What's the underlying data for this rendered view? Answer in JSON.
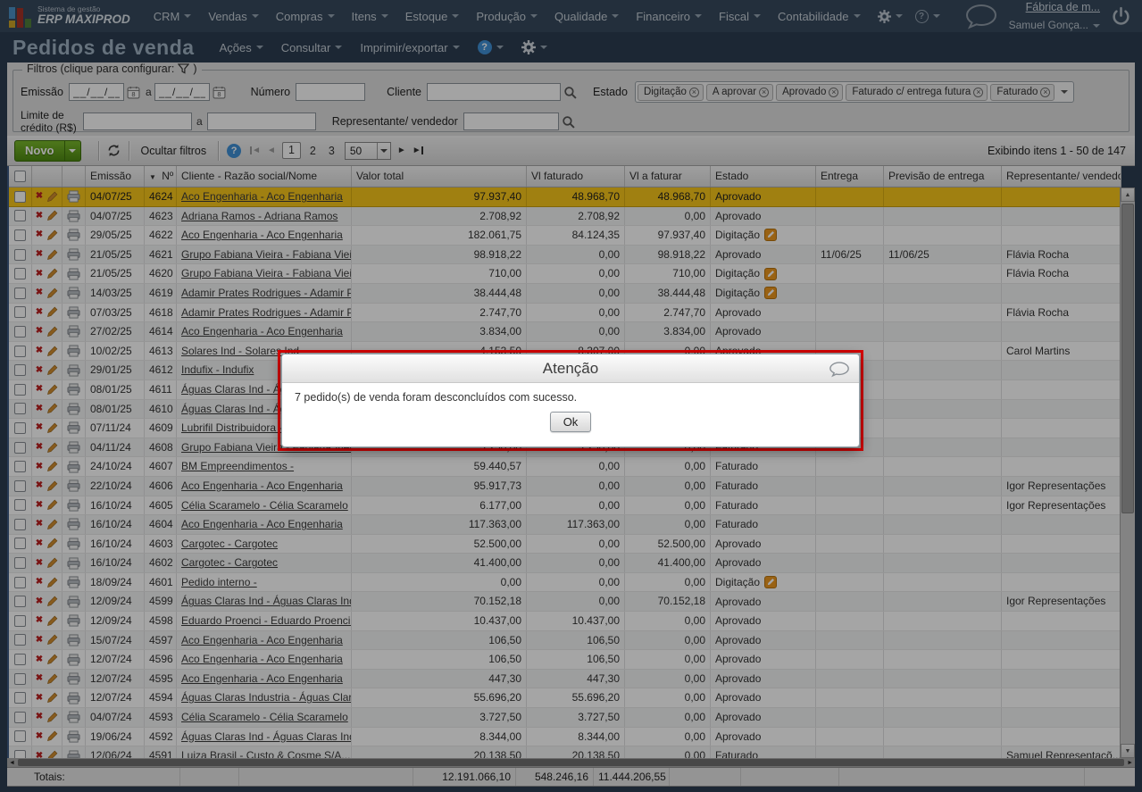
{
  "topnav": {
    "brand_small": "Sistema de gestão",
    "brand": "ERP MAXIPROD",
    "menus": [
      "CRM",
      "Vendas",
      "Compras",
      "Itens",
      "Estoque",
      "Produção",
      "Qualidade",
      "Financeiro",
      "Fiscal",
      "Contabilidade"
    ],
    "company": "Fábrica de m...",
    "user": "Samuel Gonça..."
  },
  "titlebar": {
    "title": "Pedidos de venda",
    "menus": [
      "Ações",
      "Consultar",
      "Imprimir/exportar"
    ]
  },
  "filters": {
    "legend": "Filtros (clique para configurar:",
    "legend_suffix": ")",
    "emissao_label": "Emissão",
    "a_label": "a",
    "date_placeholder": "__/__/__",
    "numero_label": "Número",
    "cliente_label": "Cliente",
    "estado_label": "Estado",
    "estado_chips": [
      "Digitação",
      "A aprovar",
      "Aprovado",
      "Faturado c/ entrega futura",
      "Faturado"
    ],
    "limite_label": "Limite de crédito (R$)",
    "representante_label": "Representante/ vendedor"
  },
  "toolbar": {
    "novo_label": "Novo",
    "ocultar_label": "Ocultar filtros",
    "pages": [
      "1",
      "2",
      "3"
    ],
    "current_page": "1",
    "page_size": "50",
    "showing": "Exibindo itens 1 - 50 de 147"
  },
  "table": {
    "columns": [
      "Emissão",
      "Nº",
      "Cliente - Razão social/Nome",
      "Valor total",
      "Vl faturado",
      "Vl a faturar",
      "Estado",
      "Entrega",
      "Previsão de entrega",
      "Representante/ vendedor"
    ],
    "rows": [
      {
        "emissao": "04/07/25",
        "numero": "4624",
        "cliente": "Aco Engenharia - Aco Engenharia",
        "valor_total": "97.937,40",
        "vl_faturado": "48.968,70",
        "vl_a_faturar": "48.968,70",
        "estado": "Aprovado",
        "entrega": "",
        "previsao": "",
        "representante": "",
        "selected": true
      },
      {
        "emissao": "04/07/25",
        "numero": "4623",
        "cliente": "Adriana Ramos - Adriana Ramos",
        "valor_total": "2.708,92",
        "vl_faturado": "2.708,92",
        "vl_a_faturar": "0,00",
        "estado": "Aprovado",
        "entrega": "",
        "previsao": "",
        "representante": ""
      },
      {
        "emissao": "29/05/25",
        "numero": "4622",
        "cliente": "Aco Engenharia - Aco Engenharia",
        "valor_total": "182.061,75",
        "vl_faturado": "84.124,35",
        "vl_a_faturar": "97.937,40",
        "estado": "Digitação",
        "entrega": "",
        "previsao": "",
        "representante": ""
      },
      {
        "emissao": "21/05/25",
        "numero": "4621",
        "cliente": "Grupo Fabiana Vieira - Fabiana Vieira",
        "valor_total": "98.918,22",
        "vl_faturado": "0,00",
        "vl_a_faturar": "98.918,22",
        "estado": "Aprovado",
        "entrega": "11/06/25",
        "previsao": "11/06/25",
        "representante": "Flávia Rocha"
      },
      {
        "emissao": "21/05/25",
        "numero": "4620",
        "cliente": "Grupo Fabiana Vieira - Fabiana Vieira",
        "valor_total": "710,00",
        "vl_faturado": "0,00",
        "vl_a_faturar": "710,00",
        "estado": "Digitação",
        "entrega": "",
        "previsao": "",
        "representante": "Flávia Rocha"
      },
      {
        "emissao": "14/03/25",
        "numero": "4619",
        "cliente": "Adamir Prates Rodrigues - Adamir Prate...",
        "valor_total": "38.444,48",
        "vl_faturado": "0,00",
        "vl_a_faturar": "38.444,48",
        "estado": "Digitação",
        "entrega": "",
        "previsao": "",
        "representante": ""
      },
      {
        "emissao": "07/03/25",
        "numero": "4618",
        "cliente": "Adamir Prates Rodrigues - Adamir Prate...",
        "valor_total": "2.747,70",
        "vl_faturado": "0,00",
        "vl_a_faturar": "2.747,70",
        "estado": "Aprovado",
        "entrega": "",
        "previsao": "",
        "representante": "Flávia Rocha"
      },
      {
        "emissao": "27/02/25",
        "numero": "4614",
        "cliente": "Aco Engenharia - Aco Engenharia",
        "valor_total": "3.834,00",
        "vl_faturado": "0,00",
        "vl_a_faturar": "3.834,00",
        "estado": "Aprovado",
        "entrega": "",
        "previsao": "",
        "representante": ""
      },
      {
        "emissao": "10/02/25",
        "numero": "4613",
        "cliente": "Solares Ind - Solares Ind",
        "valor_total": "4.153,50",
        "vl_faturado": "8.307,00",
        "vl_a_faturar": "0,00",
        "estado": "Aprovado",
        "entrega": "",
        "previsao": "",
        "representante": "Carol Martins"
      },
      {
        "emissao": "29/01/25",
        "numero": "4612",
        "cliente": "Indufix - Indufix",
        "valor_total": "",
        "vl_faturado": "",
        "vl_a_faturar": "",
        "estado": "",
        "entrega": "",
        "previsao": "",
        "representante": ""
      },
      {
        "emissao": "08/01/25",
        "numero": "4611",
        "cliente": "Águas Claras Ind - Águas Claras Industr...",
        "valor_total": "",
        "vl_faturado": "",
        "vl_a_faturar": "",
        "estado": "",
        "entrega": "",
        "previsao": "",
        "representante": ""
      },
      {
        "emissao": "08/01/25",
        "numero": "4610",
        "cliente": "Águas Claras Ind - Águas Claras Industr...",
        "valor_total": "",
        "vl_faturado": "",
        "vl_a_faturar": "",
        "estado": "",
        "entrega": "",
        "previsao": "",
        "representante": ""
      },
      {
        "emissao": "07/11/24",
        "numero": "4609",
        "cliente": "Lubrifil Distribuidora -",
        "valor_total": "",
        "vl_faturado": "",
        "vl_a_faturar": "",
        "estado": "",
        "entrega": "",
        "previsao": "",
        "representante": ""
      },
      {
        "emissao": "04/11/24",
        "numero": "4608",
        "cliente": "Grupo Fabiana Vieira - Fabiana Vieira",
        "valor_total": "5.250,00",
        "vl_faturado": "5.250,00",
        "vl_a_faturar": "0,00",
        "estado": "Faturado",
        "entrega": "",
        "previsao": "",
        "representante": ""
      },
      {
        "emissao": "24/10/24",
        "numero": "4607",
        "cliente": "BM Empreendimentos -",
        "valor_total": "59.440,57",
        "vl_faturado": "0,00",
        "vl_a_faturar": "0,00",
        "estado": "Faturado",
        "entrega": "",
        "previsao": "",
        "representante": ""
      },
      {
        "emissao": "22/10/24",
        "numero": "4606",
        "cliente": "Aco Engenharia - Aco Engenharia",
        "valor_total": "95.917,73",
        "vl_faturado": "0,00",
        "vl_a_faturar": "0,00",
        "estado": "Faturado",
        "entrega": "",
        "previsao": "",
        "representante": "Igor Representações"
      },
      {
        "emissao": "16/10/24",
        "numero": "4605",
        "cliente": "Célia Scaramelo - Célia Scaramelo",
        "valor_total": "6.177,00",
        "vl_faturado": "0,00",
        "vl_a_faturar": "0,00",
        "estado": "Faturado",
        "entrega": "",
        "previsao": "",
        "representante": "Igor Representações"
      },
      {
        "emissao": "16/10/24",
        "numero": "4604",
        "cliente": "Aco Engenharia - Aco Engenharia",
        "valor_total": "117.363,00",
        "vl_faturado": "117.363,00",
        "vl_a_faturar": "0,00",
        "estado": "Faturado",
        "entrega": "",
        "previsao": "",
        "representante": ""
      },
      {
        "emissao": "16/10/24",
        "numero": "4603",
        "cliente": "Cargotec - Cargotec",
        "valor_total": "52.500,00",
        "vl_faturado": "0,00",
        "vl_a_faturar": "52.500,00",
        "estado": "Aprovado",
        "entrega": "",
        "previsao": "",
        "representante": ""
      },
      {
        "emissao": "16/10/24",
        "numero": "4602",
        "cliente": "Cargotec - Cargotec",
        "valor_total": "41.400,00",
        "vl_faturado": "0,00",
        "vl_a_faturar": "41.400,00",
        "estado": "Aprovado",
        "entrega": "",
        "previsao": "",
        "representante": ""
      },
      {
        "emissao": "18/09/24",
        "numero": "4601",
        "cliente": "Pedido interno -",
        "valor_total": "0,00",
        "vl_faturado": "0,00",
        "vl_a_faturar": "0,00",
        "estado": "Digitação",
        "entrega": "",
        "previsao": "",
        "representante": ""
      },
      {
        "emissao": "12/09/24",
        "numero": "4599",
        "cliente": "Águas Claras Ind - Águas Claras Industr...",
        "valor_total": "70.152,18",
        "vl_faturado": "0,00",
        "vl_a_faturar": "70.152,18",
        "estado": "Aprovado",
        "entrega": "",
        "previsao": "",
        "representante": "Igor Representações"
      },
      {
        "emissao": "12/09/24",
        "numero": "4598",
        "cliente": "Eduardo Proenci - Eduardo Proenci ME",
        "valor_total": "10.437,00",
        "vl_faturado": "10.437,00",
        "vl_a_faturar": "0,00",
        "estado": "Aprovado",
        "entrega": "",
        "previsao": "",
        "representante": ""
      },
      {
        "emissao": "15/07/24",
        "numero": "4597",
        "cliente": "Aco Engenharia - Aco Engenharia",
        "valor_total": "106,50",
        "vl_faturado": "106,50",
        "vl_a_faturar": "0,00",
        "estado": "Aprovado",
        "entrega": "",
        "previsao": "",
        "representante": ""
      },
      {
        "emissao": "12/07/24",
        "numero": "4596",
        "cliente": "Aco Engenharia - Aco Engenharia",
        "valor_total": "106,50",
        "vl_faturado": "106,50",
        "vl_a_faturar": "0,00",
        "estado": "Aprovado",
        "entrega": "",
        "previsao": "",
        "representante": ""
      },
      {
        "emissao": "12/07/24",
        "numero": "4595",
        "cliente": "Aco Engenharia - Aco Engenharia",
        "valor_total": "447,30",
        "vl_faturado": "447,30",
        "vl_a_faturar": "0,00",
        "estado": "Aprovado",
        "entrega": "",
        "previsao": "",
        "representante": ""
      },
      {
        "emissao": "12/07/24",
        "numero": "4594",
        "cliente": "Águas Claras Industria - Águas Claras I...",
        "valor_total": "55.696,20",
        "vl_faturado": "55.696,20",
        "vl_a_faturar": "0,00",
        "estado": "Aprovado",
        "entrega": "",
        "previsao": "",
        "representante": ""
      },
      {
        "emissao": "04/07/24",
        "numero": "4593",
        "cliente": "Célia Scaramelo - Célia Scaramelo",
        "valor_total": "3.727,50",
        "vl_faturado": "3.727,50",
        "vl_a_faturar": "0,00",
        "estado": "Aprovado",
        "entrega": "",
        "previsao": "",
        "representante": ""
      },
      {
        "emissao": "19/06/24",
        "numero": "4592",
        "cliente": "Águas Claras Ind - Águas Claras Industr...",
        "valor_total": "8.344,00",
        "vl_faturado": "8.344,00",
        "vl_a_faturar": "0,00",
        "estado": "Aprovado",
        "entrega": "",
        "previsao": "",
        "representante": ""
      },
      {
        "emissao": "12/06/24",
        "numero": "4591",
        "cliente": "Luiza Brasil - Custo & Cosme S/A...",
        "valor_total": "20.138,50",
        "vl_faturado": "20.138,50",
        "vl_a_faturar": "0,00",
        "estado": "Faturado",
        "entrega": "",
        "previsao": "",
        "representante": "Samuel Representaçõ..."
      }
    ]
  },
  "totals": {
    "label": "Totais:",
    "valor_total": "12.191.066,10",
    "vl_faturado": "548.246,16",
    "vl_a_faturar": "11.444.206,55"
  },
  "modal": {
    "title": "Atenção",
    "message": "7 pedido(s) de venda foram desconcluídos com sucesso.",
    "ok_label": "Ok"
  }
}
